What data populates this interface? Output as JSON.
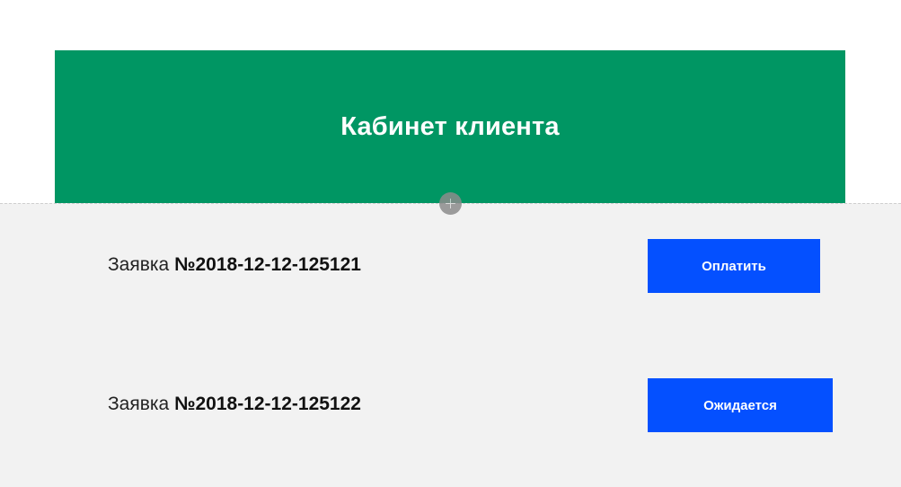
{
  "header": {
    "title": "Кабинет клиента",
    "background_color": "#009663"
  },
  "orders": [
    {
      "prefix": "Заявка ",
      "number": "№2018-12-12-125121",
      "button_label": "Оплатить"
    },
    {
      "prefix": "Заявка ",
      "number": "№2018-12-12-125122",
      "button_label": "Ожидается"
    }
  ],
  "colors": {
    "button": "#0450ff",
    "content_background": "#f2f2f2"
  },
  "icons": {
    "add_block": "plus-icon"
  }
}
